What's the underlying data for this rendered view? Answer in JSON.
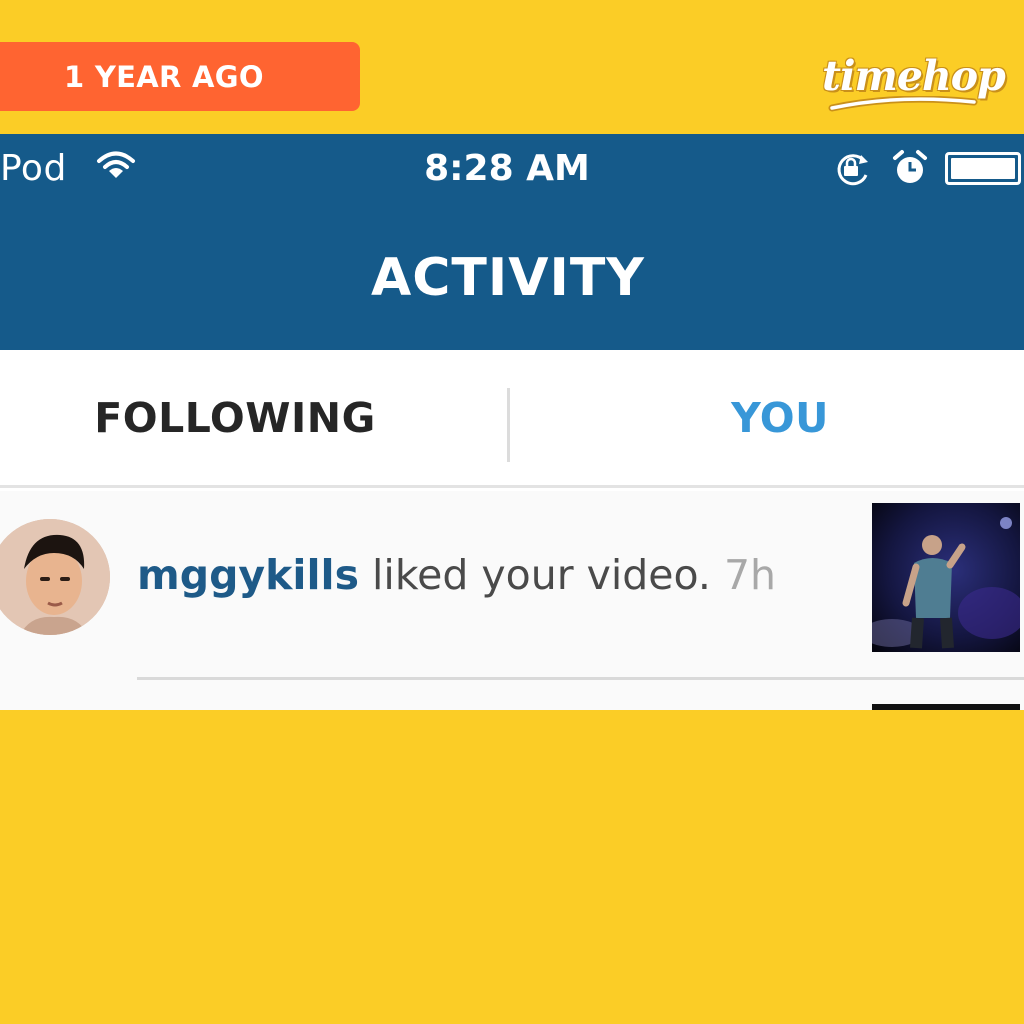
{
  "frame": {
    "badge_label": "1 YEAR AGO",
    "logo_text": "timehop",
    "colors": {
      "background": "#fbcd26",
      "badge": "#ff6431"
    }
  },
  "statusbar": {
    "carrier": "Pod",
    "time": "8:28 AM",
    "icons": [
      "wifi-icon",
      "rotation-lock-icon",
      "alarm-icon",
      "battery-icon"
    ]
  },
  "header": {
    "title": "ACTIVITY",
    "color": "#155a8a"
  },
  "tabs": [
    {
      "label": "FOLLOWING",
      "active": false
    },
    {
      "label": "YOU",
      "active": true,
      "color": "#3897d8"
    }
  ],
  "feed": {
    "items": [
      {
        "username": "mggykills",
        "action": "liked your video.",
        "time": "7h"
      }
    ]
  }
}
